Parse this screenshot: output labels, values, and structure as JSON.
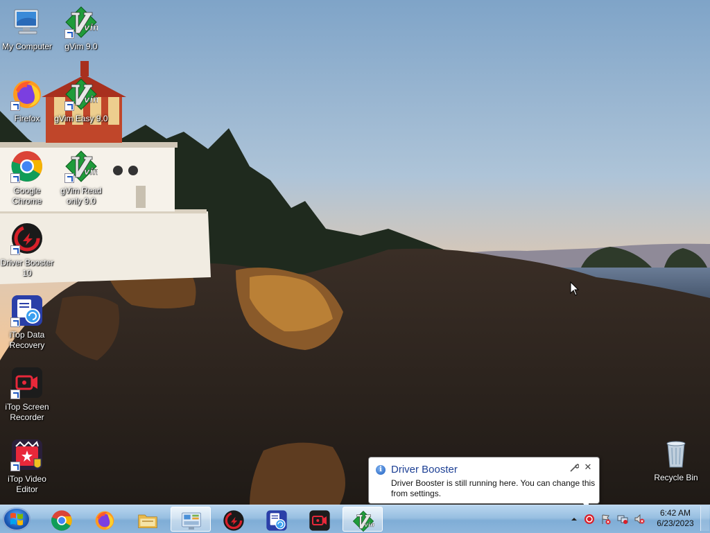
{
  "desktop": {
    "icons": [
      {
        "label": "My Computer",
        "icon": "computer-icon"
      },
      {
        "label": "gVim 9.0",
        "icon": "vim-icon"
      },
      {
        "label": "Firefox",
        "icon": "firefox-icon"
      },
      {
        "label": "gVim Easy 9.0",
        "icon": "vim-icon"
      },
      {
        "label": "Google Chrome",
        "icon": "chrome-icon"
      },
      {
        "label": "gVim Read only 9.0",
        "icon": "vim-icon"
      },
      {
        "label": "Driver Booster 10",
        "icon": "driver-booster-icon"
      },
      {
        "label": "iTop Data Recovery",
        "icon": "itop-data-recovery-icon"
      },
      {
        "label": "iTop Screen Recorder",
        "icon": "itop-screen-recorder-icon"
      },
      {
        "label": "iTop Video Editor",
        "icon": "itop-video-editor-icon"
      },
      {
        "label": "Recycle Bin",
        "icon": "recycle-bin-icon"
      }
    ]
  },
  "taskbar": {
    "pinned": [
      {
        "name": "chrome",
        "icon": "chrome-icon"
      },
      {
        "name": "firefox",
        "icon": "firefox-icon"
      },
      {
        "name": "explorer",
        "icon": "folder-icon"
      },
      {
        "name": "control-panel",
        "icon": "control-panel-icon",
        "active": true
      },
      {
        "name": "driver-booster",
        "icon": "driver-booster-icon"
      },
      {
        "name": "itop-data-recovery",
        "icon": "itop-data-recovery-icon"
      },
      {
        "name": "itop-screen-recorder",
        "icon": "itop-screen-recorder-icon"
      },
      {
        "name": "gvim",
        "icon": "vim-icon",
        "active": true
      }
    ],
    "clock": {
      "time": "6:42 AM",
      "date": "6/23/2023"
    }
  },
  "notification": {
    "title": "Driver Booster",
    "body": "Driver Booster is still running here. You can change this from settings.",
    "close_glyph": "✕"
  },
  "colors": {
    "accent": "#1c3f94",
    "vim_green": "#1f9b3a",
    "booster_red": "#d8202a"
  }
}
